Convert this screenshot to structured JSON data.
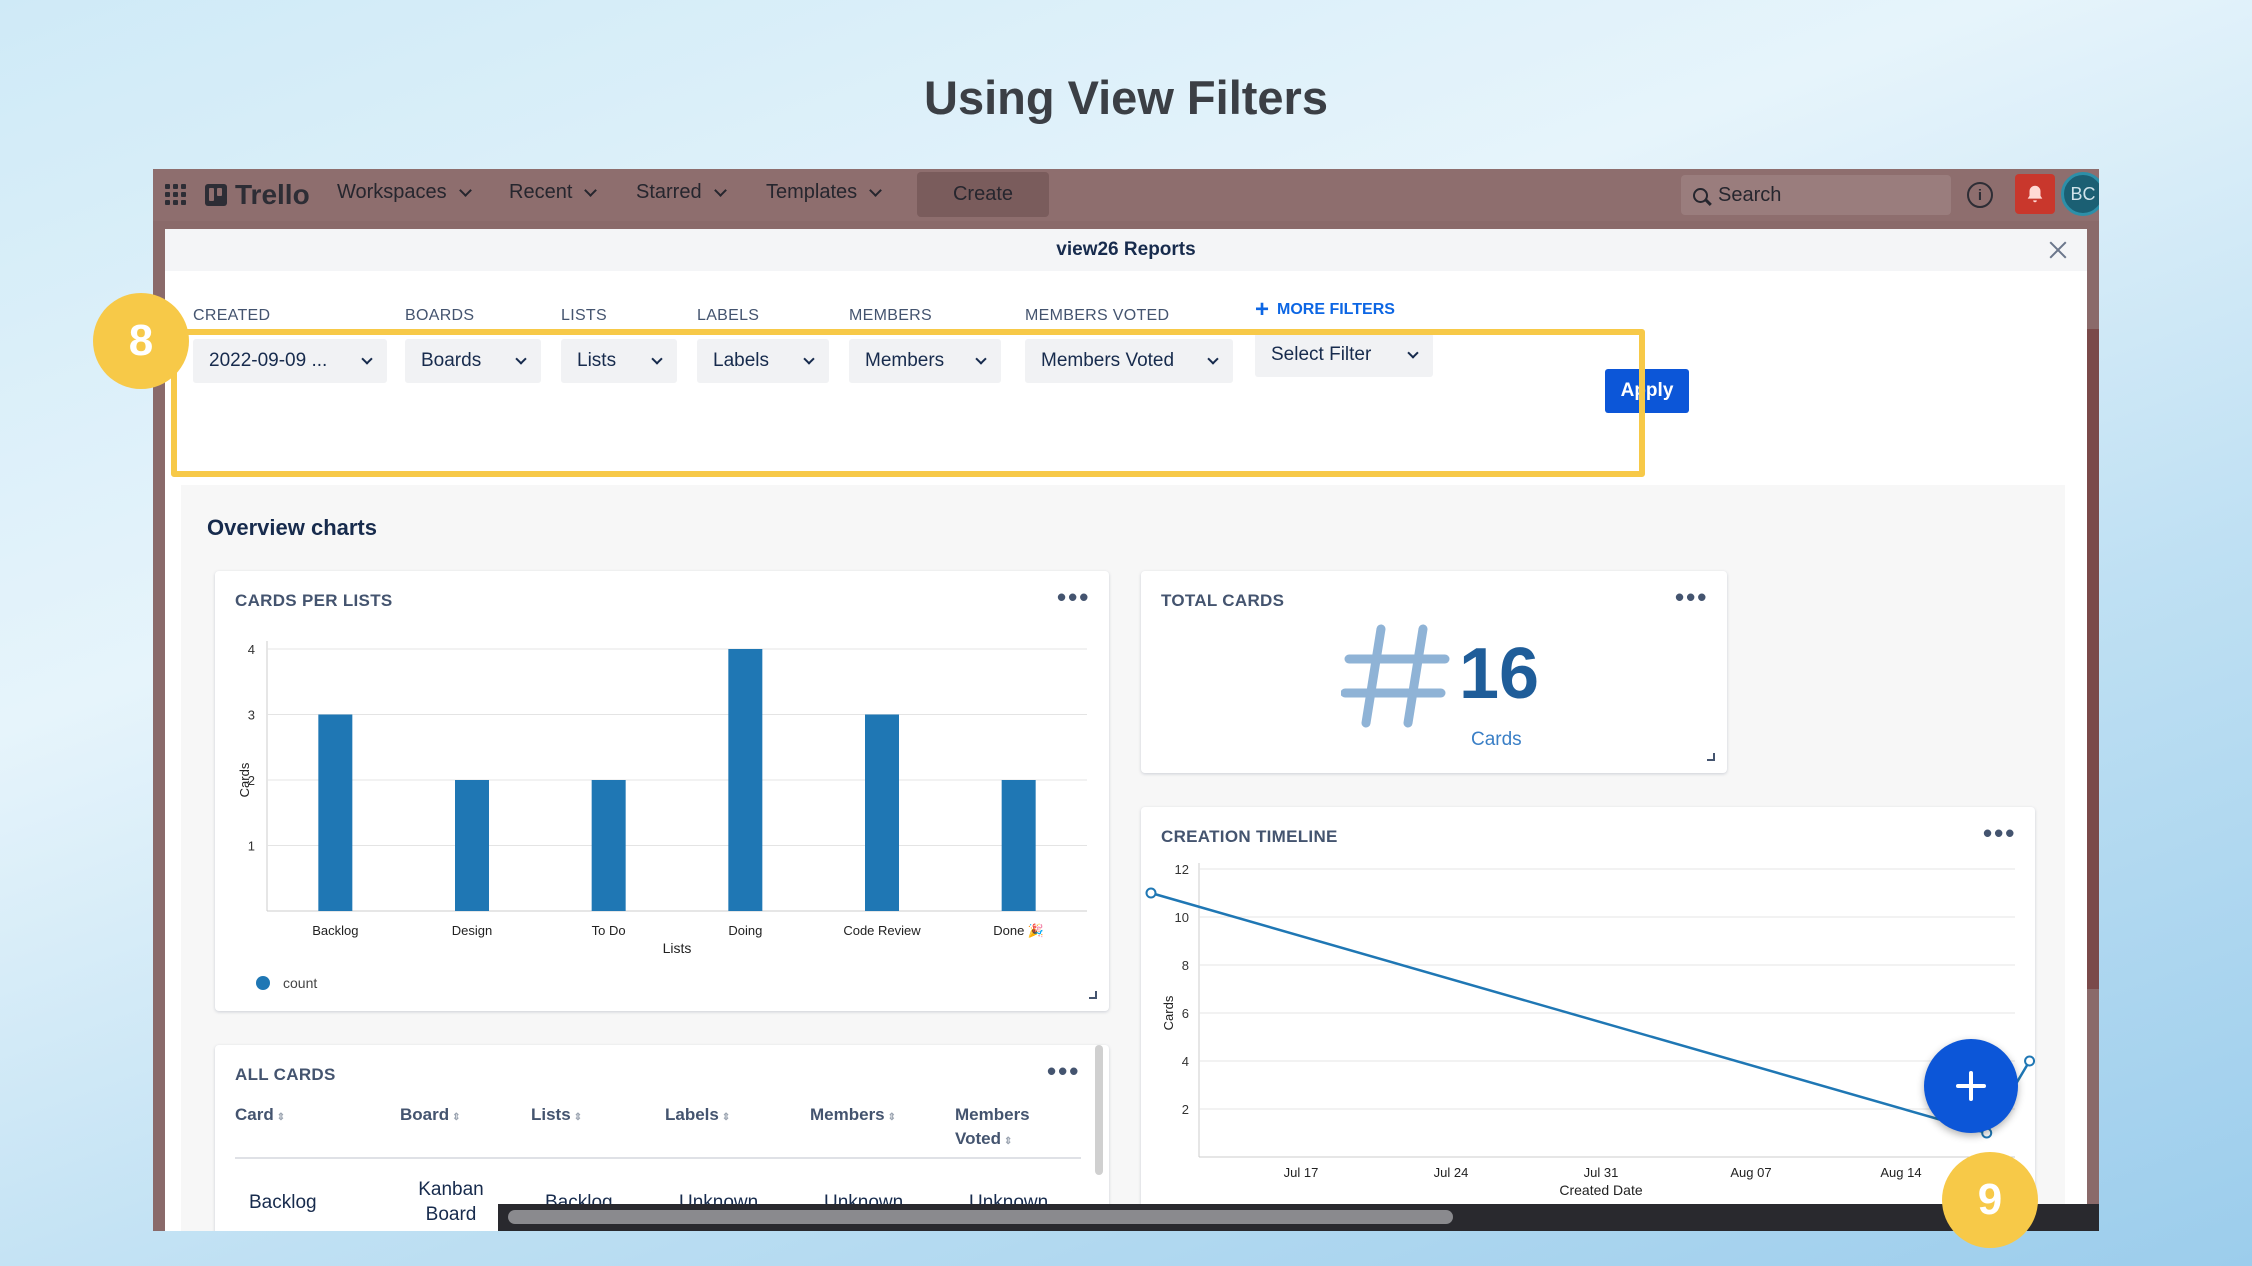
{
  "page_title": "Using View Filters",
  "topbar": {
    "logo": "Trello",
    "nav": [
      "Workspaces",
      "Recent",
      "Starred",
      "Templates"
    ],
    "create_label": "Create",
    "search_label": "Search",
    "info_glyph": "i",
    "avatar_initials": "BC",
    "accent_color": "#c9372c"
  },
  "modal": {
    "title": "view26 Reports",
    "filters": {
      "created_label": "CREATED",
      "created_value": "2022-09-09 ...",
      "boards_label": "BOARDS",
      "boards_value": "Boards",
      "lists_label": "LISTS",
      "lists_value": "Lists",
      "labels_label": "LABELS",
      "labels_value": "Labels",
      "members_label": "MEMBERS",
      "members_value": "Members",
      "members_voted_label": "MEMBERS VOTED",
      "members_voted_value": "Members Voted",
      "more_filters_label": "MORE FILTERS",
      "select_filter_value": "Select Filter",
      "apply_label": "Apply"
    },
    "overview_title": "Overview charts",
    "cards_per_lists": {
      "title": "CARDS PER LISTS",
      "more": "•••"
    },
    "total_cards": {
      "title": "TOTAL CARDS",
      "value": "16",
      "unit": "Cards",
      "more": "•••"
    },
    "creation_timeline": {
      "title": "CREATION TIMELINE",
      "more": "•••"
    },
    "all_cards": {
      "title": "ALL CARDS",
      "more": "•••",
      "columns": [
        "Card",
        "Board",
        "Lists",
        "Labels",
        "Members",
        "Members Voted"
      ],
      "rows": [
        [
          "Backlog",
          "Kanban Board",
          "Backlog",
          "Unknown",
          "Unknown",
          "Unknown"
        ]
      ]
    }
  },
  "badges": {
    "step_8": "8",
    "step_9": "9"
  },
  "chart_data": [
    {
      "type": "bar",
      "title": "CARDS PER LISTS",
      "categories": [
        "Backlog",
        "Design",
        "To Do",
        "Doing",
        "Code Review",
        "Done 🎉"
      ],
      "series": [
        {
          "name": "count",
          "values": [
            3,
            2,
            2,
            4,
            3,
            2
          ]
        }
      ],
      "xlabel": "Lists",
      "ylabel": "Cards",
      "ylim": [
        0,
        4
      ],
      "yticks": [
        1,
        2,
        3,
        4
      ],
      "grid": true,
      "legend": "bottom-left",
      "color": "#1f77b4"
    },
    {
      "type": "line",
      "title": "CREATION TIMELINE",
      "x": [
        "Jul 10",
        "Aug 18",
        "Aug 20"
      ],
      "series": [
        {
          "name": "count",
          "values": [
            11,
            1,
            4
          ]
        }
      ],
      "xticks": [
        "Jul 17",
        "Jul 24",
        "Jul 31",
        "Aug 07",
        "Aug 14"
      ],
      "xlabel": "Created Date",
      "ylabel": "Cards",
      "ylim": [
        0,
        12
      ],
      "yticks": [
        2,
        4,
        6,
        8,
        10,
        12
      ],
      "grid": true,
      "legend": "bottom-left",
      "color": "#1f77b4"
    }
  ]
}
